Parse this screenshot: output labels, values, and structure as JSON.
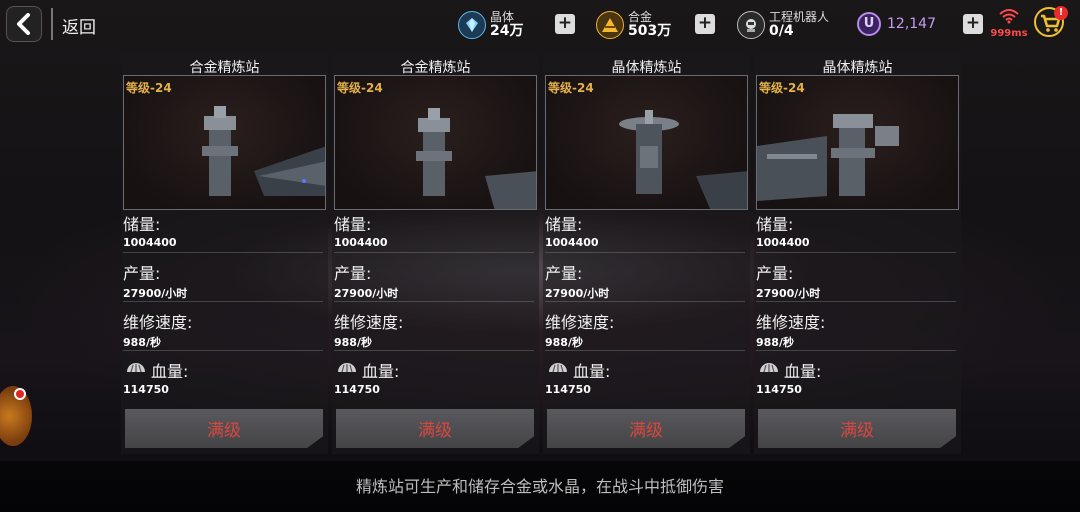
{
  "header": {
    "back_label": "返回",
    "resources": [
      {
        "name": "晶体",
        "value": "24万",
        "icon": "crystal-icon"
      },
      {
        "name": "合金",
        "value": "503万",
        "icon": "alloy-icon"
      },
      {
        "name": "工程机器人",
        "value": "0/4",
        "icon": "robot-icon"
      }
    ],
    "u_currency": {
      "icon_label": "U",
      "value": "12,147"
    },
    "ping": "999ms",
    "cart_badge": "!"
  },
  "cards": [
    {
      "title": "合金精炼站",
      "level": "等级-24",
      "storage_label": "储量:",
      "storage": "1004400",
      "output_label": "产量:",
      "output": "27900/小时",
      "repair_label": "维修速度:",
      "repair": "988/秒",
      "hp_label": "血量:",
      "hp": "114750",
      "button": "满级"
    },
    {
      "title": "合金精炼站",
      "level": "等级-24",
      "storage_label": "储量:",
      "storage": "1004400",
      "output_label": "产量:",
      "output": "27900/小时",
      "repair_label": "维修速度:",
      "repair": "988/秒",
      "hp_label": "血量:",
      "hp": "114750",
      "button": "满级"
    },
    {
      "title": "晶体精炼站",
      "level": "等级-24",
      "storage_label": "储量:",
      "storage": "1004400",
      "output_label": "产量:",
      "output": "27900/小时",
      "repair_label": "维修速度:",
      "repair": "988/秒",
      "hp_label": "血量:",
      "hp": "114750",
      "button": "满级"
    },
    {
      "title": "晶体精炼站",
      "level": "等级-24",
      "storage_label": "储量:",
      "storage": "1004400",
      "output_label": "产量:",
      "output": "27900/小时",
      "repair_label": "维修速度:",
      "repair": "988/秒",
      "hp_label": "血量:",
      "hp": "114750",
      "button": "满级"
    }
  ],
  "footer": {
    "text": "精炼站可生产和储存合金或水晶，在战斗中抵御伤害"
  },
  "colors": {
    "level": "#e4b04a",
    "max_button_text": "#d9463e",
    "currency": "#c39cf2",
    "ping": "#ff4a4a"
  }
}
